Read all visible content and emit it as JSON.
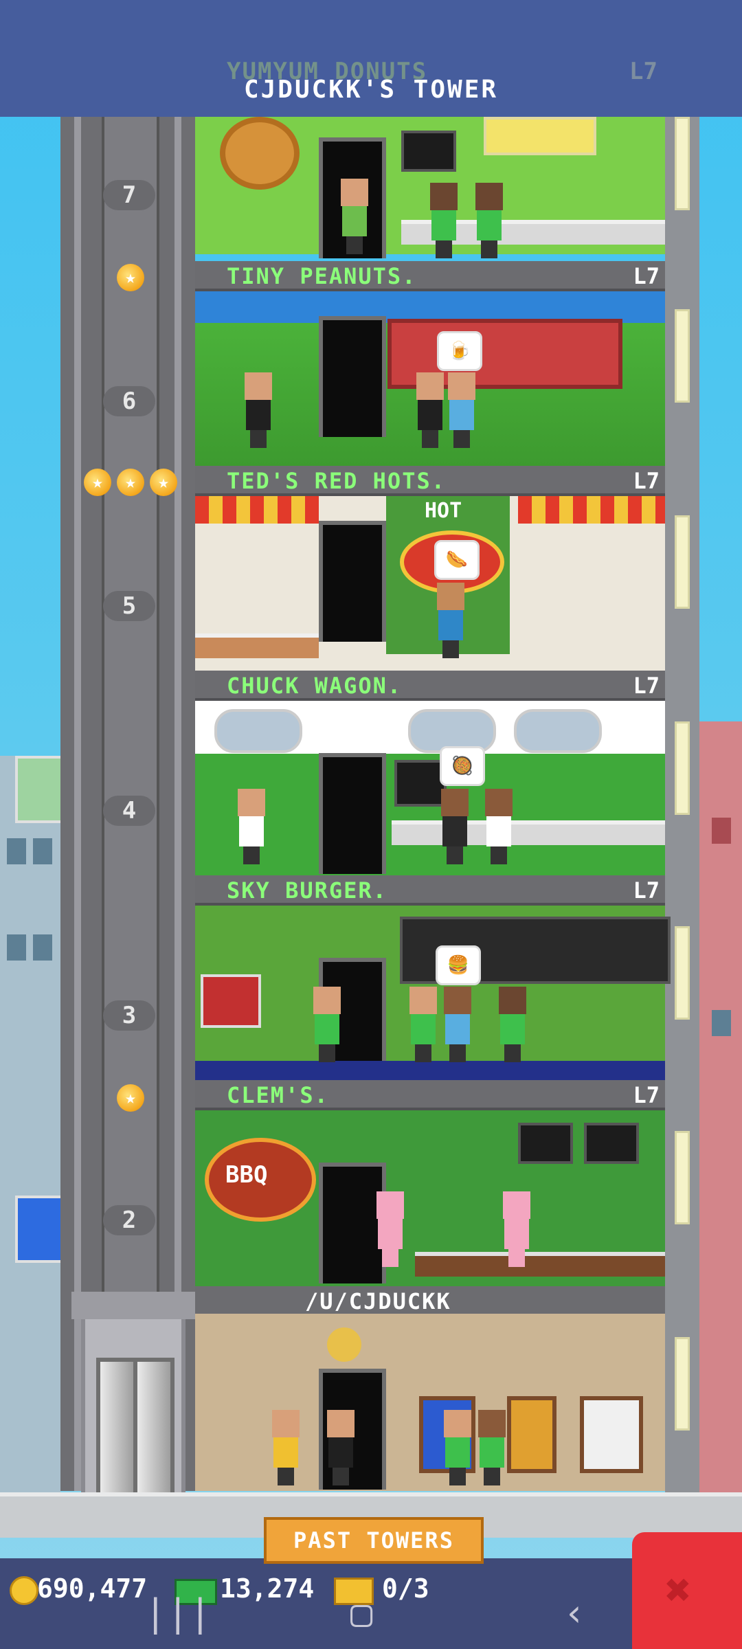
{
  "tower": {
    "title": "CJDUCKK'S TOWER",
    "ghost_floor": {
      "name": "YUMYUM DONUTS",
      "level": "L7"
    }
  },
  "floors": [
    {
      "name": "TINY PEANUTS.",
      "level": "L7",
      "number": "7"
    },
    {
      "name": "TED'S RED HOTS.",
      "level": "L7",
      "number": "6"
    },
    {
      "name": "CHUCK WAGON.",
      "level": "L7",
      "number": "5"
    },
    {
      "name": "SKY BURGER.",
      "level": "L7",
      "number": "4"
    },
    {
      "name": "CLEM'S.",
      "level": "L7",
      "number": "3"
    }
  ],
  "floor2_number": "2",
  "lobby": {
    "name": "/U/CJDUCKK"
  },
  "decor_text": {
    "hot": "HOT",
    "bbq": "BBQ"
  },
  "buttons": {
    "past_towers": "PAST TOWERS"
  },
  "stats": {
    "coins": "690,477",
    "bux": "13,274",
    "tickets": "0/3"
  },
  "icons": {
    "elevator_star": "star-icon",
    "coin": "coin-icon",
    "bux": "bux-icon",
    "ticket": "ticket-icon",
    "build": "build-icon"
  },
  "colors": {
    "floor_name": "#8bff7a",
    "accent_orange": "#f0a43a",
    "bottom_bar": "#3f4a78",
    "red_button": "#e8323a"
  }
}
